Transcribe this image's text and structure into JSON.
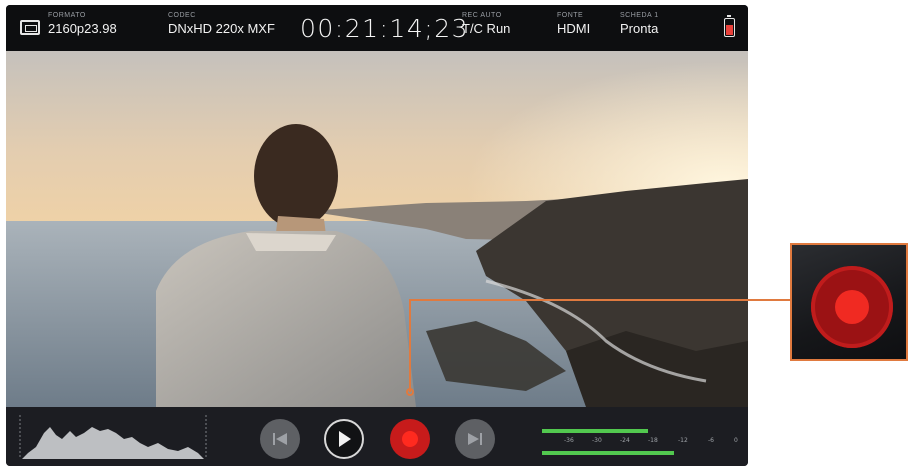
{
  "topbar": {
    "format_label": "FORMATO",
    "format_value": "2160p23.98",
    "codec_label": "CODEC",
    "codec_value": "DNxHD 220x MXF",
    "timecode": "00:21:14;23",
    "rec_label": "REC AUTO",
    "rec_value": "T/C Run",
    "source_label": "FONTE",
    "source_value": "HDMI",
    "card_label": "SCHEDA 1",
    "card_value": "Pronta",
    "icons": {
      "monitor": "monitor-icon",
      "battery": "battery-icon"
    }
  },
  "controls": {
    "previous": "skip-previous-icon",
    "play": "play-icon",
    "record": "record-icon",
    "next": "skip-next-icon"
  },
  "audio_meter": {
    "ticks": [
      "-36",
      "-30",
      "-24",
      "-18",
      "-12",
      "-6",
      "0"
    ],
    "channel_1_level": 0.53,
    "channel_2_level": 0.66,
    "color": "#52c84f"
  },
  "callout": {
    "highlighted_control": "record-button",
    "line_color": "#e07a3f",
    "record_color": "#f02a22"
  }
}
